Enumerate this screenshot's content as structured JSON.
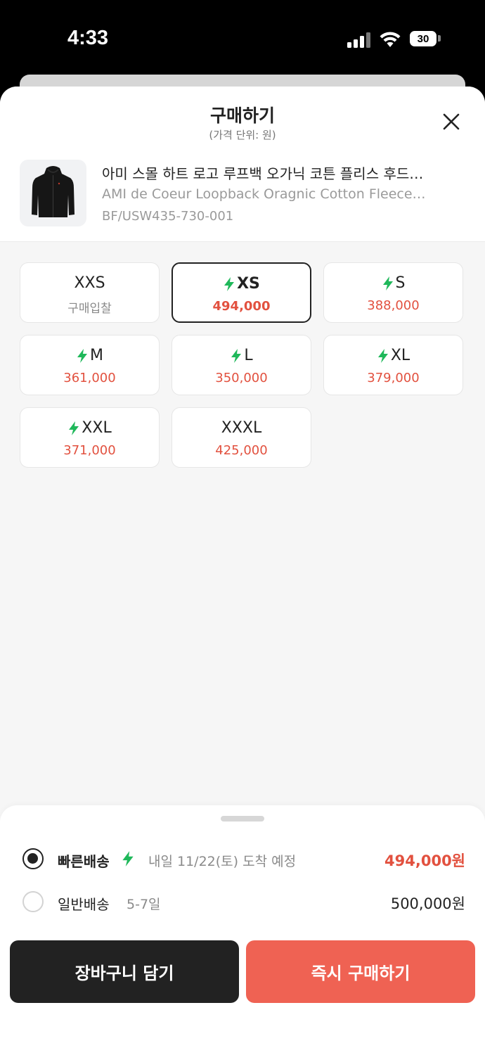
{
  "status_bar": {
    "time": "4:33",
    "battery": "30"
  },
  "header": {
    "title": "구매하기",
    "subtitle": "(가격 단위: 원)",
    "close_icon": "close-icon"
  },
  "product": {
    "name_ko": "아미 스몰 하트 로고 루프백 오가닉 코튼 플리스 후드…",
    "name_en": "AMI de Coeur Loopback Oragnic Cotton Fleece…",
    "code": "BF/USW435-730-001",
    "image_icon": "black-hoodie-image"
  },
  "sizes": [
    {
      "label": "XXS",
      "price": "구매입찰",
      "fast": false,
      "selected": false
    },
    {
      "label": "XS",
      "price": "494,000",
      "fast": true,
      "selected": true
    },
    {
      "label": "S",
      "price": "388,000",
      "fast": true,
      "selected": false
    },
    {
      "label": "M",
      "price": "361,000",
      "fast": true,
      "selected": false
    },
    {
      "label": "L",
      "price": "350,000",
      "fast": true,
      "selected": false
    },
    {
      "label": "XL",
      "price": "379,000",
      "fast": true,
      "selected": false
    },
    {
      "label": "XXL",
      "price": "371,000",
      "fast": true,
      "selected": false
    },
    {
      "label": "XXXL",
      "price": "425,000",
      "fast": false,
      "selected": false
    }
  ],
  "shipping": {
    "fast": {
      "name": "빠른배송",
      "detail": "내일 11/22(토) 도착 예정",
      "price": "494,000원",
      "selected": true
    },
    "normal": {
      "name": "일반배송",
      "detail": "5-7일",
      "price": "500,000원",
      "selected": false
    }
  },
  "buttons": {
    "cart": "장바구니 담기",
    "buy": "즉시 구매하기"
  },
  "colors": {
    "accent": "#ef6253",
    "price_red": "#e2513f",
    "bolt_green": "#1fb85a",
    "dark": "#222222"
  }
}
